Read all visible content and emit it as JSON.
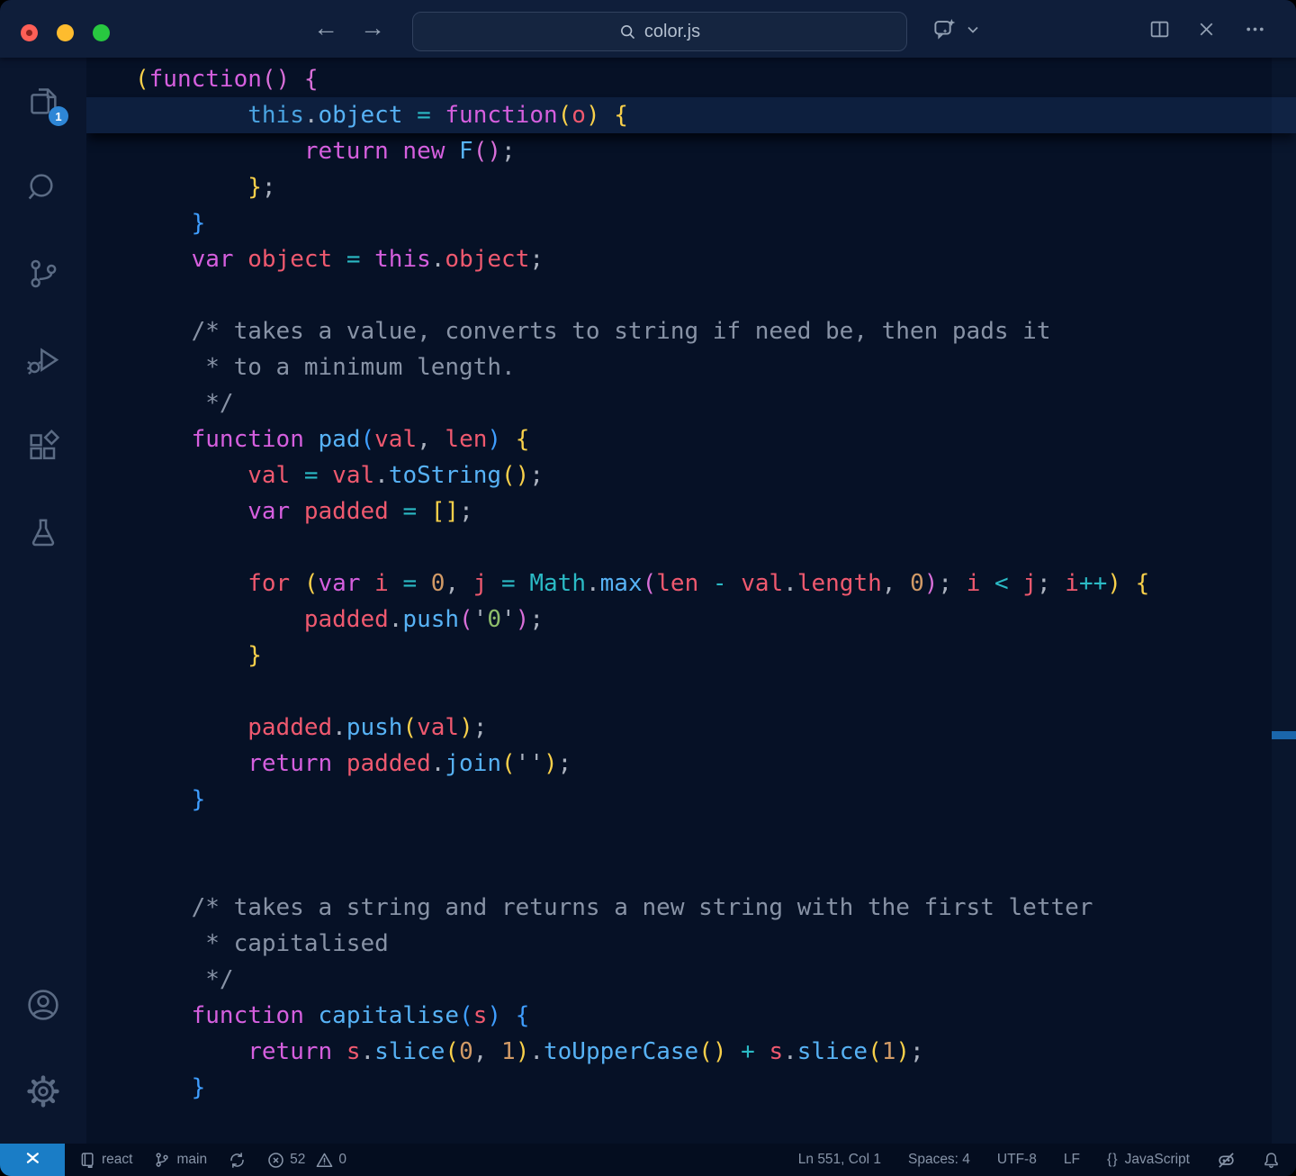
{
  "colors": {
    "ui": {
      "editor_bg": "#061126",
      "titlebar_bg": "#0f1e3a",
      "activitybar_bg": "#0a162e",
      "statusbar_bg": "#040d1f",
      "searchbox_bg": "#152540",
      "searchbox_border": "#31415e",
      "remote_blue": "#1a7dc6",
      "badge_blue": "#2e86d6",
      "marker_blue": "#1a66ab",
      "current_line_bg": "#0d1f3e",
      "traffic_red": "#ff5f57",
      "traffic_yellow": "#febc2e",
      "traffic_green": "#28c840",
      "activity_icon": "#5b6b84",
      "titlebar_icon": "#93a1b4",
      "statusbar_fg": "#8794a8",
      "title_fg": "#b3bfcf",
      "code_default": "#abb2bf"
    },
    "syntax": {
      "kw": "#d55fde",
      "var": "#ef596f",
      "fn": "#57b2f5",
      "this": "#4aa3e0",
      "op": "#2bbac5",
      "num": "#d19a66",
      "str": "#8ebd6b",
      "cm": "#8893a6",
      "by": "#f8d04a",
      "bp": "#d96fd9",
      "bb": "#3f9eff"
    }
  },
  "titlebar": {
    "filename": "color.js",
    "back_glyph": "←",
    "forward_glyph": "→",
    "icons": [
      "back-arrow",
      "forward-arrow",
      "search",
      "copilot-chat",
      "chevron-down",
      "split-editor",
      "close",
      "more-actions"
    ]
  },
  "activity_bar": {
    "explorer_badge": "1",
    "items": [
      "explorer",
      "search",
      "source-control",
      "run-and-debug",
      "extensions",
      "testing"
    ],
    "bottom_items": [
      "account",
      "settings"
    ]
  },
  "editor": {
    "current_line_index": 1,
    "lines": [
      [
        [
          "(",
          "by"
        ],
        [
          "function",
          "kw"
        ],
        [
          "()",
          "bp"
        ],
        [
          " "
        ],
        [
          "{",
          "bp"
        ]
      ],
      [
        [
          "        "
        ],
        [
          "this",
          "this"
        ],
        [
          "."
        ],
        [
          "object",
          "fn"
        ],
        [
          " "
        ],
        [
          "=",
          "op"
        ],
        [
          " "
        ],
        [
          "function",
          "kw"
        ],
        [
          "(",
          "by"
        ],
        [
          "o",
          "var"
        ],
        [
          ")",
          "by"
        ],
        [
          " "
        ],
        [
          "{",
          "by"
        ]
      ],
      [
        [
          "            "
        ],
        [
          "return",
          "kw"
        ],
        [
          " "
        ],
        [
          "new",
          "kw"
        ],
        [
          " "
        ],
        [
          "F",
          "fn"
        ],
        [
          "()",
          "bp"
        ],
        [
          ";"
        ]
      ],
      [
        [
          "        "
        ],
        [
          "}",
          "by"
        ],
        [
          ";"
        ]
      ],
      [
        [
          "    "
        ],
        [
          "}",
          "bb"
        ]
      ],
      [
        [
          "    "
        ],
        [
          "var",
          "kw"
        ],
        [
          " "
        ],
        [
          "object",
          "var"
        ],
        [
          " "
        ],
        [
          "=",
          "op"
        ],
        [
          " "
        ],
        [
          "this",
          "kw"
        ],
        [
          "."
        ],
        [
          "object",
          "var"
        ],
        [
          ";"
        ]
      ],
      [],
      [
        [
          "    /* takes a value, converts to string if need be, then pads it",
          "cm"
        ]
      ],
      [
        [
          "     * to a minimum length.",
          "cm"
        ]
      ],
      [
        [
          "     */",
          "cm"
        ]
      ],
      [
        [
          "    "
        ],
        [
          "function",
          "kw"
        ],
        [
          " "
        ],
        [
          "pad",
          "fn"
        ],
        [
          "(",
          "bb"
        ],
        [
          "val",
          "var"
        ],
        [
          ","
        ],
        [
          " "
        ],
        [
          "len",
          "var"
        ],
        [
          ")",
          "bb"
        ],
        [
          " "
        ],
        [
          "{",
          "by"
        ]
      ],
      [
        [
          "        "
        ],
        [
          "val",
          "var"
        ],
        [
          " "
        ],
        [
          "=",
          "op"
        ],
        [
          " "
        ],
        [
          "val",
          "var"
        ],
        [
          "."
        ],
        [
          "toString",
          "fn"
        ],
        [
          "()",
          "by"
        ],
        [
          ";"
        ]
      ],
      [
        [
          "        "
        ],
        [
          "var",
          "kw"
        ],
        [
          " "
        ],
        [
          "padded",
          "var"
        ],
        [
          " "
        ],
        [
          "=",
          "op"
        ],
        [
          " "
        ],
        [
          "[]",
          "by"
        ],
        [
          ";"
        ]
      ],
      [],
      [
        [
          "        "
        ],
        [
          "for",
          "var"
        ],
        [
          " "
        ],
        [
          "(",
          "by"
        ],
        [
          "var",
          "kw"
        ],
        [
          " "
        ],
        [
          "i",
          "var"
        ],
        [
          " "
        ],
        [
          "=",
          "op"
        ],
        [
          " "
        ],
        [
          "0",
          "num"
        ],
        [
          ","
        ],
        [
          " "
        ],
        [
          "j",
          "var"
        ],
        [
          " "
        ],
        [
          "=",
          "op"
        ],
        [
          " "
        ],
        [
          "Math",
          "op"
        ],
        [
          "."
        ],
        [
          "max",
          "fn"
        ],
        [
          "(",
          "bp"
        ],
        [
          "len",
          "var"
        ],
        [
          " "
        ],
        [
          "-",
          "op"
        ],
        [
          " "
        ],
        [
          "val",
          "var"
        ],
        [
          "."
        ],
        [
          "length",
          "var"
        ],
        [
          ","
        ],
        [
          " "
        ],
        [
          "0",
          "num"
        ],
        [
          ")",
          "bp"
        ],
        [
          ";"
        ],
        [
          " "
        ],
        [
          "i",
          "var"
        ],
        [
          " "
        ],
        [
          "<",
          "op"
        ],
        [
          " "
        ],
        [
          "j",
          "var"
        ],
        [
          ";"
        ],
        [
          " "
        ],
        [
          "i",
          "var"
        ],
        [
          "++",
          "op"
        ],
        [
          ")",
          "by"
        ],
        [
          " "
        ],
        [
          "{",
          "by"
        ]
      ],
      [
        [
          "            "
        ],
        [
          "padded",
          "var"
        ],
        [
          "."
        ],
        [
          "push",
          "fn"
        ],
        [
          "(",
          "bp"
        ],
        [
          "'"
        ],
        [
          "0",
          "str"
        ],
        [
          "'"
        ],
        [
          ")",
          "bp"
        ],
        [
          ";"
        ]
      ],
      [
        [
          "        "
        ],
        [
          "}",
          "by"
        ]
      ],
      [],
      [
        [
          "        "
        ],
        [
          "padded",
          "var"
        ],
        [
          "."
        ],
        [
          "push",
          "fn"
        ],
        [
          "(",
          "by"
        ],
        [
          "val",
          "var"
        ],
        [
          ")",
          "by"
        ],
        [
          ";"
        ]
      ],
      [
        [
          "        "
        ],
        [
          "return",
          "kw"
        ],
        [
          " "
        ],
        [
          "padded",
          "var"
        ],
        [
          "."
        ],
        [
          "join",
          "fn"
        ],
        [
          "(",
          "by"
        ],
        [
          "''"
        ],
        [
          ")",
          "by"
        ],
        [
          ";"
        ]
      ],
      [
        [
          "    "
        ],
        [
          "}",
          "bb"
        ]
      ],
      [],
      [],
      [
        [
          "    /* takes a string and returns a new string with the first letter",
          "cm"
        ]
      ],
      [
        [
          "     * capitalised",
          "cm"
        ]
      ],
      [
        [
          "     */",
          "cm"
        ]
      ],
      [
        [
          "    "
        ],
        [
          "function",
          "kw"
        ],
        [
          " "
        ],
        [
          "capitalise",
          "fn"
        ],
        [
          "(",
          "bb"
        ],
        [
          "s",
          "var"
        ],
        [
          ")",
          "bb"
        ],
        [
          " "
        ],
        [
          "{",
          "bb"
        ]
      ],
      [
        [
          "        "
        ],
        [
          "return",
          "kw"
        ],
        [
          " "
        ],
        [
          "s",
          "var"
        ],
        [
          "."
        ],
        [
          "slice",
          "fn"
        ],
        [
          "(",
          "by"
        ],
        [
          "0",
          "num"
        ],
        [
          ","
        ],
        [
          " "
        ],
        [
          "1",
          "num"
        ],
        [
          ")",
          "by"
        ],
        [
          "."
        ],
        [
          "toUpperCase",
          "fn"
        ],
        [
          "()",
          "by"
        ],
        [
          " "
        ],
        [
          "+",
          "op"
        ],
        [
          " "
        ],
        [
          "s",
          "var"
        ],
        [
          "."
        ],
        [
          "slice",
          "fn"
        ],
        [
          "(",
          "by"
        ],
        [
          "1",
          "num"
        ],
        [
          ")",
          "by"
        ],
        [
          ";"
        ]
      ],
      [
        [
          "    "
        ],
        [
          "}",
          "bb"
        ]
      ],
      []
    ]
  },
  "status_bar": {
    "repo_label": "react",
    "branch_label": "main",
    "errors": "52",
    "warnings": "0",
    "line_col": "Ln 551, Col 1",
    "indentation": "Spaces: 4",
    "encoding": "UTF-8",
    "eol": "LF",
    "braces_glyph": "{}",
    "language": "JavaScript",
    "icons": [
      "remote-indicator",
      "repo",
      "git-branch",
      "sync",
      "error",
      "warning",
      "copilot-disabled",
      "bell"
    ]
  }
}
